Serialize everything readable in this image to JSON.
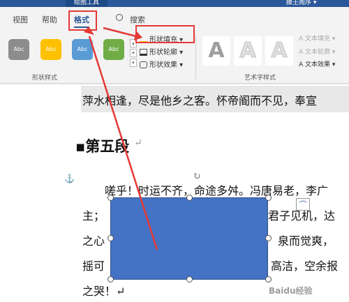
{
  "title_bar": {
    "context_tab": "绘图工具",
    "user": "滕王阁序 ▾"
  },
  "tabs": [
    "视图",
    "帮助",
    "格式",
    "搜索"
  ],
  "shape_styles": {
    "swatch_label": "Abc",
    "colors": [
      "#8c8c8c",
      "#ffc000",
      "#5b9bd5",
      "#70ad47"
    ],
    "group_label": "形状样式"
  },
  "commands": {
    "fill": "形状填充",
    "outline": "形状轮廓",
    "effects": "形状效果"
  },
  "wordart": {
    "letter": "A",
    "text_fill": "文本填充",
    "text_outline": "文本轮廓",
    "text_effects": "文本效果",
    "group_label": "艺术字样式"
  },
  "document": {
    "line1": "萍水相逢，尽是他乡之客。怀帝阍而不见，奉宣",
    "heading": "▪第五段",
    "para1": "嗟乎！时运不齐，命途多舛。冯唐易老，李广",
    "para2a": "主；",
    "para2b": "君子见机，达",
    "para3a": "之心",
    "para3b": "泉而觉爽，",
    "para4a": "摇可",
    "para4b": "高洁，空余报",
    "para5": "之哭！↵",
    "return_mark": "↵"
  },
  "watermark": "Baidu经验"
}
